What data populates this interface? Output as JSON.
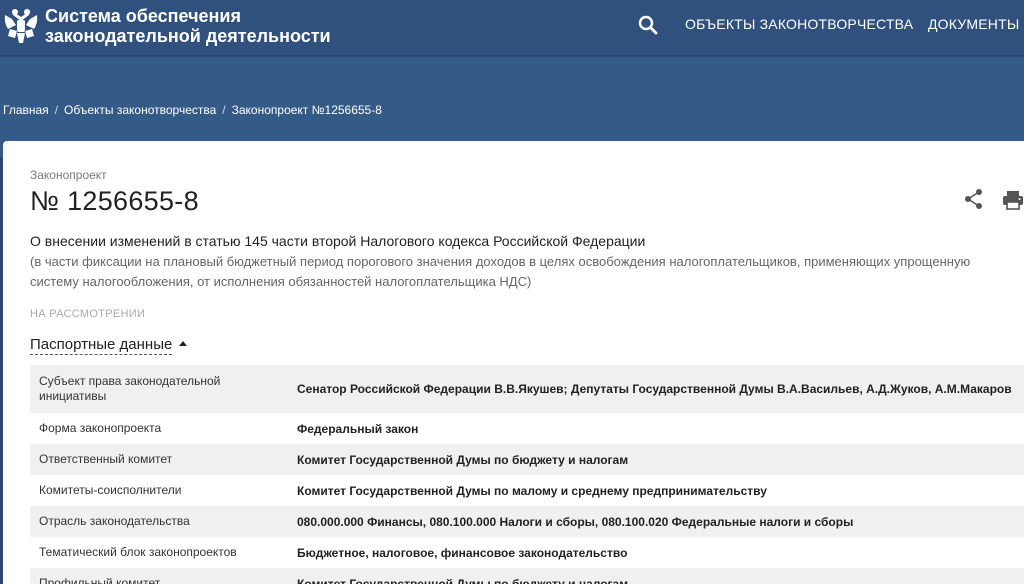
{
  "header": {
    "title_line1": "Система обеспечения",
    "title_line2": "законодательной деятельности",
    "search_icon": "search-icon",
    "nav": [
      {
        "label": "ОБЪЕКТЫ ЗАКОНОТВОРЧЕСТВА"
      },
      {
        "label": "ДОКУМЕНТЫ"
      }
    ]
  },
  "breadcrumb": {
    "items": [
      "Главная",
      "Объекты законотворчества",
      "Законопроект №1256655-8"
    ],
    "separator": "/"
  },
  "bill": {
    "kind": "Законопроект",
    "number": "№ 1256655-8",
    "title": "О внесении изменений в статью 145 части второй Налогового кодекса Российской Федерации",
    "subtitle": "(в части фиксации на плановый бюджетный период порогового значения доходов в целях освобождения налогоплательщиков, применяющих упрощенную систему налогообложения, от исполнения обязанностей налогоплательщика НДС)",
    "status": "НА РАССМОТРЕНИИ",
    "share_icon": "share-icon",
    "print_icon": "print-icon"
  },
  "passport": {
    "label": "Паспортные данные",
    "rows": [
      {
        "key": "Субъект права законодательной инициативы",
        "value": "Сенатор Российской Федерации В.В.Якушев; Депутаты Государственной Думы В.А.Васильев, А.Д.Жуков, А.М.Макаров"
      },
      {
        "key": "Форма законопроекта",
        "value": "Федеральный закон"
      },
      {
        "key": "Ответственный комитет",
        "value": "Комитет Государственной Думы по бюджету и налогам"
      },
      {
        "key": "Комитеты-соисполнители",
        "value": "Комитет Государственной Думы по малому и среднему предпринимательству"
      },
      {
        "key": "Отрасль законодательства",
        "value": "080.000.000 Финансы, 080.100.000 Налоги и сборы, 080.100.020 Федеральные налоги и сборы"
      },
      {
        "key": "Тематический блок законопроектов",
        "value": "Бюджетное, налоговое, финансовое законодательство"
      },
      {
        "key": "Профильный комитет",
        "value": "Комитет Государственной Думы по бюджету и налогам"
      }
    ]
  },
  "colors": {
    "header_bg": "#30507d",
    "hero_bg": "#345a88",
    "row_stripe": "#f0f0f0"
  }
}
